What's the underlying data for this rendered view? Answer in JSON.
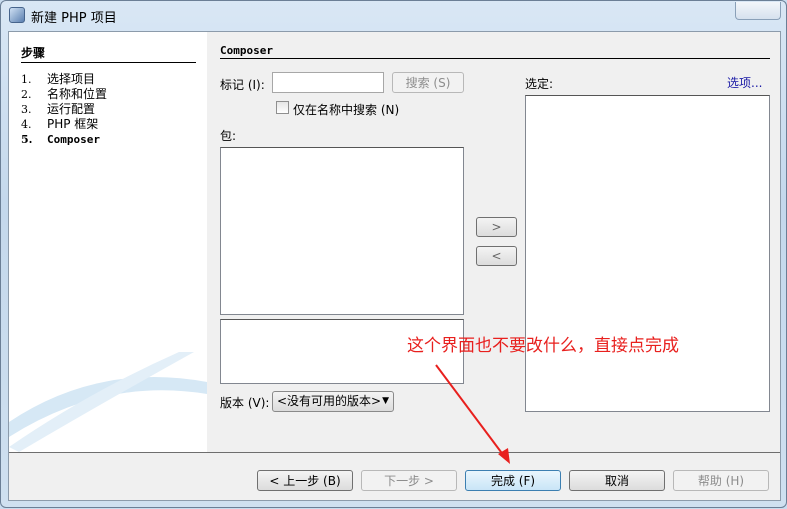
{
  "window": {
    "title": "新建 PHP 项目"
  },
  "steps": {
    "heading": "步骤",
    "items": [
      {
        "num": "1.",
        "label": "选择项目"
      },
      {
        "num": "2.",
        "label": "名称和位置"
      },
      {
        "num": "3.",
        "label": "运行配置"
      },
      {
        "num": "4.",
        "label": "PHP 框架"
      },
      {
        "num": "5.",
        "label": "Composer"
      }
    ]
  },
  "panel": {
    "heading": "Composer",
    "token_label": "标记 (I):",
    "token_value": "",
    "search_button": "搜索 (S)",
    "name_only_label": "仅在名称中搜索 (N)",
    "packages_label": "包:",
    "selected_label": "选定:",
    "options_link": "选项...",
    "add_button": ">",
    "remove_button": "<",
    "version_label": "版本 (V):",
    "version_value": "<没有可用的版本>"
  },
  "buttons": {
    "back": "< 上一步 (B)",
    "next": "下一步 >",
    "finish": "完成 (F)",
    "cancel": "取消",
    "help": "帮助 (H)"
  },
  "annotation": {
    "text": "这个界面也不要改什么，直接点完成",
    "color": "#e8201e"
  }
}
